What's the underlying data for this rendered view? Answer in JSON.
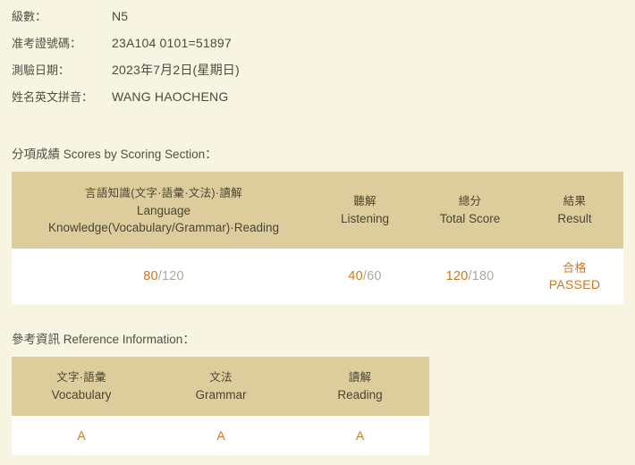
{
  "candidate_info": {
    "rows": [
      {
        "label": "級數：",
        "value": "N5"
      },
      {
        "label": "准考證號碼：",
        "value": "23A104 0101=51897"
      },
      {
        "label": "測驗日期：",
        "value": "2023年7月2日(星期日)"
      },
      {
        "label": "姓名英文拼音：",
        "value": "WANG HAOCHENG"
      }
    ]
  },
  "scores_section": {
    "caption": "分項成績 Scores by Scoring Section：",
    "columns": [
      {
        "cjk": "言語知識(文字·語彙·文法)·讀解",
        "en_line1": "Language",
        "en_line2": "Knowledge(Vocabulary/Grammar)·Reading"
      },
      {
        "cjk": "聽解",
        "en_line1": "Listening",
        "en_line2": ""
      },
      {
        "cjk": "總分",
        "en_line1": "Total Score",
        "en_line2": ""
      },
      {
        "cjk": "結果",
        "en_line1": "Result",
        "en_line2": ""
      }
    ],
    "values": {
      "language_score": "80",
      "language_max": "/120",
      "listening_score": "40",
      "listening_max": "/60",
      "total_score": "120",
      "total_max": "/180",
      "result_cjk": "合格",
      "result_en": "PASSED"
    }
  },
  "reference_section": {
    "caption": "參考資訊 Reference Information：",
    "columns": [
      {
        "cjk": "文字·語彙",
        "en": "Vocabulary"
      },
      {
        "cjk": "文法",
        "en": "Grammar"
      },
      {
        "cjk": "讀解",
        "en": "Reading"
      }
    ],
    "grades": [
      "A",
      "A",
      "A"
    ]
  },
  "colors": {
    "page_background": "#f7f5e1",
    "table_header": "#ddcd9c",
    "row_background": "#ffffff",
    "accent_orange": "#cc7722",
    "muted_text": "#a9a9a0"
  }
}
